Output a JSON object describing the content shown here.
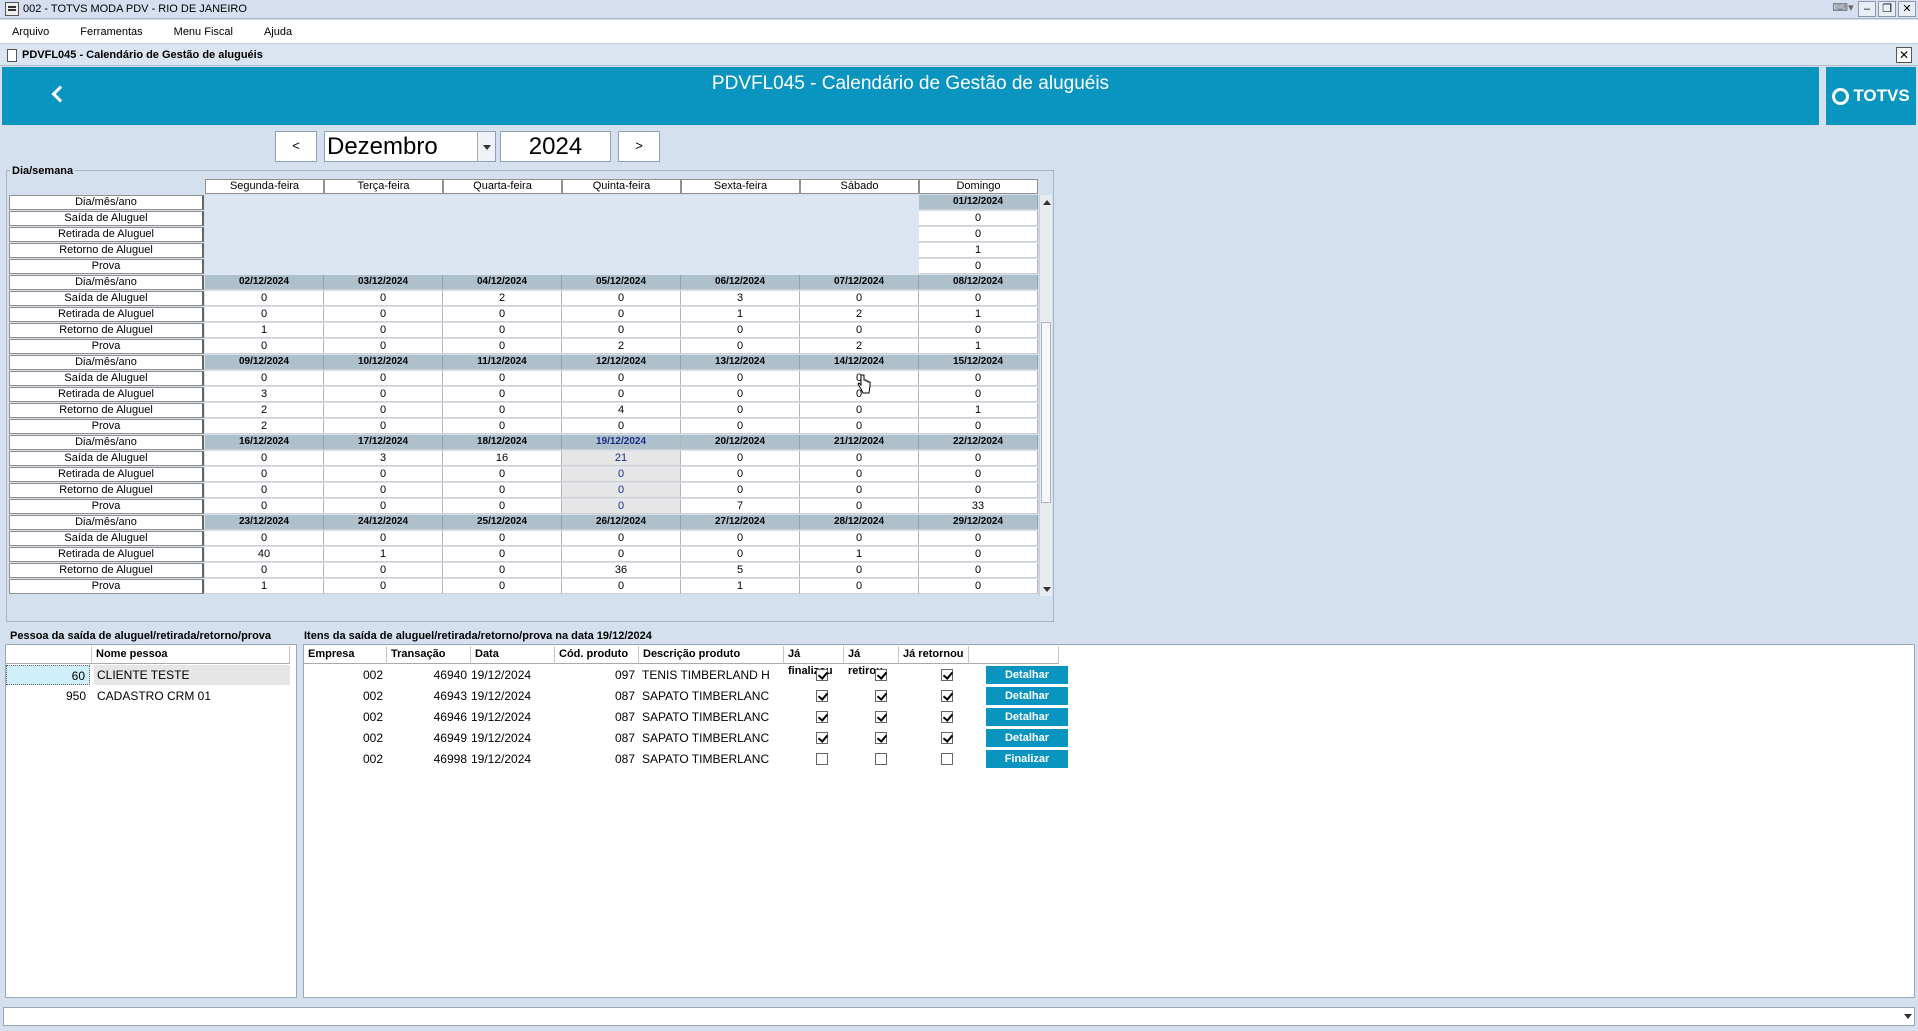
{
  "window": {
    "title": "002 - TOTVS MODA PDV - RIO DE JANEIRO"
  },
  "menu": [
    "Arquivo",
    "Ferramentas",
    "Menu Fiscal",
    "Ajuda"
  ],
  "subwindow": {
    "title": "PDVFL045 - Calendário de Gestão de aluguéis"
  },
  "header": {
    "title": "PDVFL045 - Calendário de Gestão de aluguéis",
    "logo": "TOTVS"
  },
  "nav": {
    "prev": "<",
    "next": ">",
    "month": "Dezembro",
    "year": "2024"
  },
  "calendar": {
    "section_label": "Dia/semana",
    "weekdays": [
      "Segunda-feira",
      "Terça-feira",
      "Quarta-feira",
      "Quinta-feira",
      "Sexta-feira",
      "Sábado",
      "Domingo"
    ],
    "row_labels": [
      "Dia/mês/ano",
      "Saída de Aluguel",
      "Retirada de Aluguel",
      "Retorno de Aluguel",
      "Prova"
    ],
    "weeks": [
      {
        "dates": [
          "",
          "",
          "",
          "",
          "",
          "",
          "01/12/2024"
        ],
        "saida": [
          "",
          "",
          "",
          "",
          "",
          "",
          "0"
        ],
        "retirada": [
          "",
          "",
          "",
          "",
          "",
          "",
          "0"
        ],
        "retorno": [
          "",
          "",
          "",
          "",
          "",
          "",
          "1"
        ],
        "prova": [
          "",
          "",
          "",
          "",
          "",
          "",
          "0"
        ]
      },
      {
        "dates": [
          "02/12/2024",
          "03/12/2024",
          "04/12/2024",
          "05/12/2024",
          "06/12/2024",
          "07/12/2024",
          "08/12/2024"
        ],
        "saida": [
          "0",
          "0",
          "2",
          "0",
          "3",
          "0",
          "0"
        ],
        "retirada": [
          "0",
          "0",
          "0",
          "0",
          "1",
          "2",
          "1"
        ],
        "retorno": [
          "1",
          "0",
          "0",
          "0",
          "0",
          "0",
          "0"
        ],
        "prova": [
          "0",
          "0",
          "0",
          "2",
          "0",
          "2",
          "1"
        ]
      },
      {
        "dates": [
          "09/12/2024",
          "10/12/2024",
          "11/12/2024",
          "12/12/2024",
          "13/12/2024",
          "14/12/2024",
          "15/12/2024"
        ],
        "saida": [
          "0",
          "0",
          "0",
          "0",
          "0",
          "0",
          "0"
        ],
        "retirada": [
          "3",
          "0",
          "0",
          "0",
          "0",
          "0",
          "0"
        ],
        "retorno": [
          "2",
          "0",
          "0",
          "4",
          "0",
          "0",
          "1"
        ],
        "prova": [
          "2",
          "0",
          "0",
          "0",
          "0",
          "0",
          "0"
        ]
      },
      {
        "dates": [
          "16/12/2024",
          "17/12/2024",
          "18/12/2024",
          "19/12/2024",
          "20/12/2024",
          "21/12/2024",
          "22/12/2024"
        ],
        "saida": [
          "0",
          "3",
          "16",
          "21",
          "0",
          "0",
          "0"
        ],
        "retirada": [
          "0",
          "0",
          "0",
          "0",
          "0",
          "0",
          "0"
        ],
        "retorno": [
          "0",
          "0",
          "0",
          "0",
          "0",
          "0",
          "0"
        ],
        "prova": [
          "0",
          "0",
          "0",
          "0",
          "7",
          "0",
          "33"
        ]
      },
      {
        "dates": [
          "23/12/2024",
          "24/12/2024",
          "25/12/2024",
          "26/12/2024",
          "27/12/2024",
          "28/12/2024",
          "29/12/2024"
        ],
        "saida": [
          "0",
          "0",
          "0",
          "0",
          "0",
          "0",
          "0"
        ],
        "retirada": [
          "40",
          "1",
          "0",
          "0",
          "0",
          "1",
          "0"
        ],
        "retorno": [
          "0",
          "0",
          "0",
          "36",
          "5",
          "0",
          "0"
        ],
        "prova": [
          "1",
          "0",
          "0",
          "0",
          "1",
          "0",
          "0"
        ]
      }
    ],
    "selected": {
      "week": 3,
      "day": 3
    }
  },
  "persons": {
    "section_label": "Pessoa da saída de aluguel/retirada/retorno/prova",
    "columns": [
      "",
      "Nome pessoa"
    ],
    "rows": [
      {
        "code": "60",
        "name": "CLIENTE TESTE"
      },
      {
        "code": "950",
        "name": "CADASTRO CRM 01"
      }
    ]
  },
  "items": {
    "section_label": "Itens da saída de aluguel/retirada/retorno/prova na data 19/12/2024",
    "columns": [
      "Empresa",
      "Transação",
      "Data",
      "Cód. produto",
      "Descrição produto",
      "Já finalizou",
      "Já retirou",
      "Já retornou",
      ""
    ],
    "rows": [
      {
        "empresa": "002",
        "transacao": "46940",
        "data": "19/12/2024",
        "cod": "097",
        "descricao": "TENIS TIMBERLAND H",
        "finalizou": true,
        "retirou": true,
        "retornou": true,
        "action": "Detalhar"
      },
      {
        "empresa": "002",
        "transacao": "46943",
        "data": "19/12/2024",
        "cod": "087",
        "descricao": "SAPATO TIMBERLANC",
        "finalizou": true,
        "retirou": true,
        "retornou": true,
        "action": "Detalhar"
      },
      {
        "empresa": "002",
        "transacao": "46946",
        "data": "19/12/2024",
        "cod": "087",
        "descricao": "SAPATO TIMBERLANC",
        "finalizou": true,
        "retirou": true,
        "retornou": true,
        "action": "Detalhar"
      },
      {
        "empresa": "002",
        "transacao": "46949",
        "data": "19/12/2024",
        "cod": "087",
        "descricao": "SAPATO TIMBERLANC",
        "finalizou": true,
        "retirou": true,
        "retornou": true,
        "action": "Detalhar"
      },
      {
        "empresa": "002",
        "transacao": "46998",
        "data": "19/12/2024",
        "cod": "087",
        "descricao": "SAPATO TIMBERLANC",
        "finalizou": false,
        "retirou": false,
        "retornou": false,
        "action": "Finalizar"
      }
    ]
  },
  "colors": {
    "accent": "#0a95c1",
    "date_header": "#aec0cc",
    "background": "#d4e0ee"
  }
}
